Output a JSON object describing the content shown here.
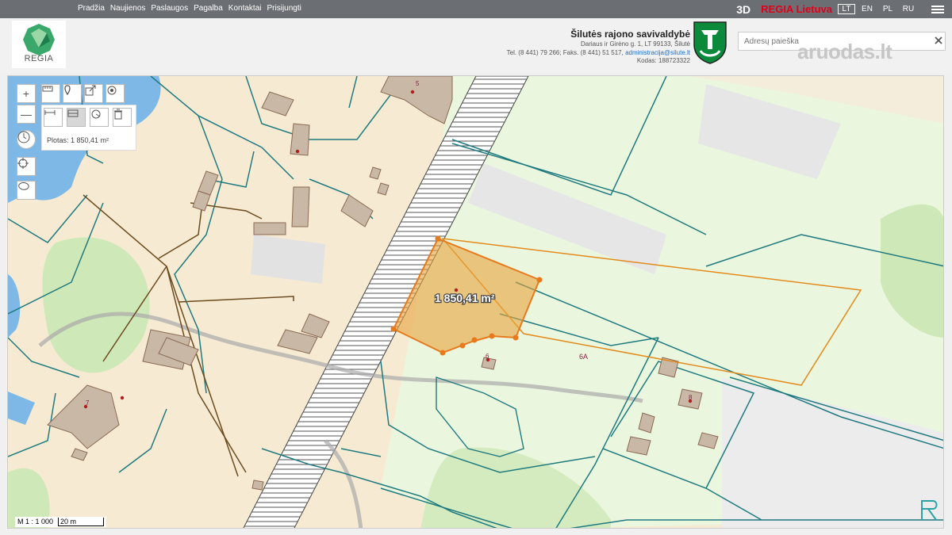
{
  "topbar": {
    "nav": [
      "Pradžia",
      "Naujienos",
      "Paslaugos",
      "Pagalba",
      "Kontaktai",
      "Prisijungti"
    ],
    "btn_3d": "3D",
    "regia_lt": "REGIA Lietuva",
    "languages": [
      "LT",
      "EN",
      "PL",
      "RU"
    ],
    "active_language": "LT"
  },
  "header": {
    "logo_text": "REGIA",
    "municipality": "Šilutės rajono savivaldybė",
    "address": "Dariaus ir Girėno g. 1, LT 99133, Šilutė",
    "phone": "Tel. (8 441) 79 266; Faks. (8 441) 51 517,",
    "email": "administracija@silute.lt",
    "code": "Kodas: 188723322",
    "search_placeholder": "Adresų paieška",
    "watermark": "aruodas.lt"
  },
  "map": {
    "tools": {
      "zoom_in": "+",
      "zoom_out": "—",
      "measure_result": "Plotas: 1 850,41 m²"
    },
    "area_label": "1 850,41 m²",
    "parcel_numbers": [
      "5",
      "7",
      "6",
      "6A",
      "8"
    ],
    "scale_ratio": "M 1 : 1 000",
    "scale_bar": "20 m",
    "colors": {
      "parcel_line": "#1f7a80",
      "measured_area": "#e8a23c",
      "orange_outline": "#e38a1c",
      "road_line": "#6b4a1e",
      "water": "#7db8e6",
      "green": "#c8e6b0"
    }
  }
}
